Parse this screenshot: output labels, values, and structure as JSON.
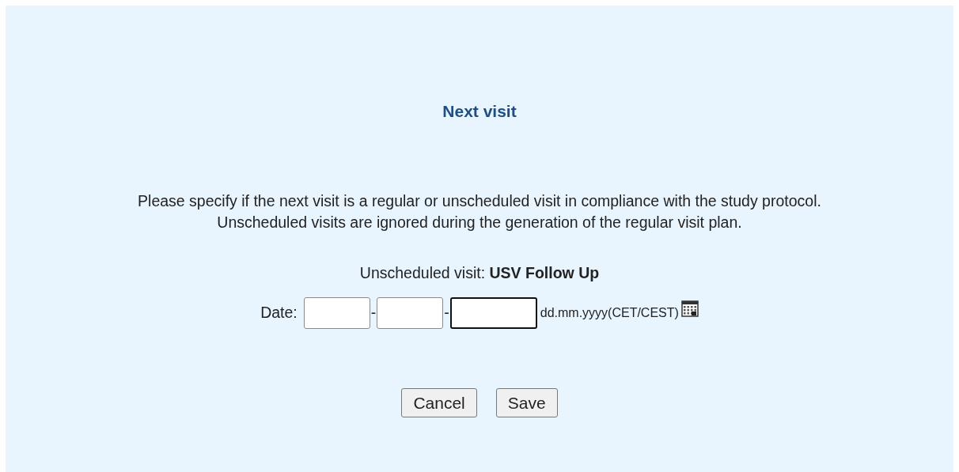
{
  "dialog": {
    "title": "Next visit",
    "description": [
      "Please specify if the next visit is a regular or unscheduled visit in compliance with the study protocol.",
      "Unscheduled visits are ignored during the generation of the regular visit plan."
    ],
    "visit": {
      "label": "Unscheduled visit:",
      "value": "USV Follow Up"
    },
    "date": {
      "label": "Date:",
      "fields": [
        {
          "focused": false
        },
        {
          "focused": false
        },
        {
          "focused": true
        }
      ],
      "separators": [
        "-",
        "-"
      ],
      "format_hint": "dd.mm.yyyy(CET/CEST)"
    },
    "buttons": [
      "Cancel",
      "Save"
    ]
  }
}
